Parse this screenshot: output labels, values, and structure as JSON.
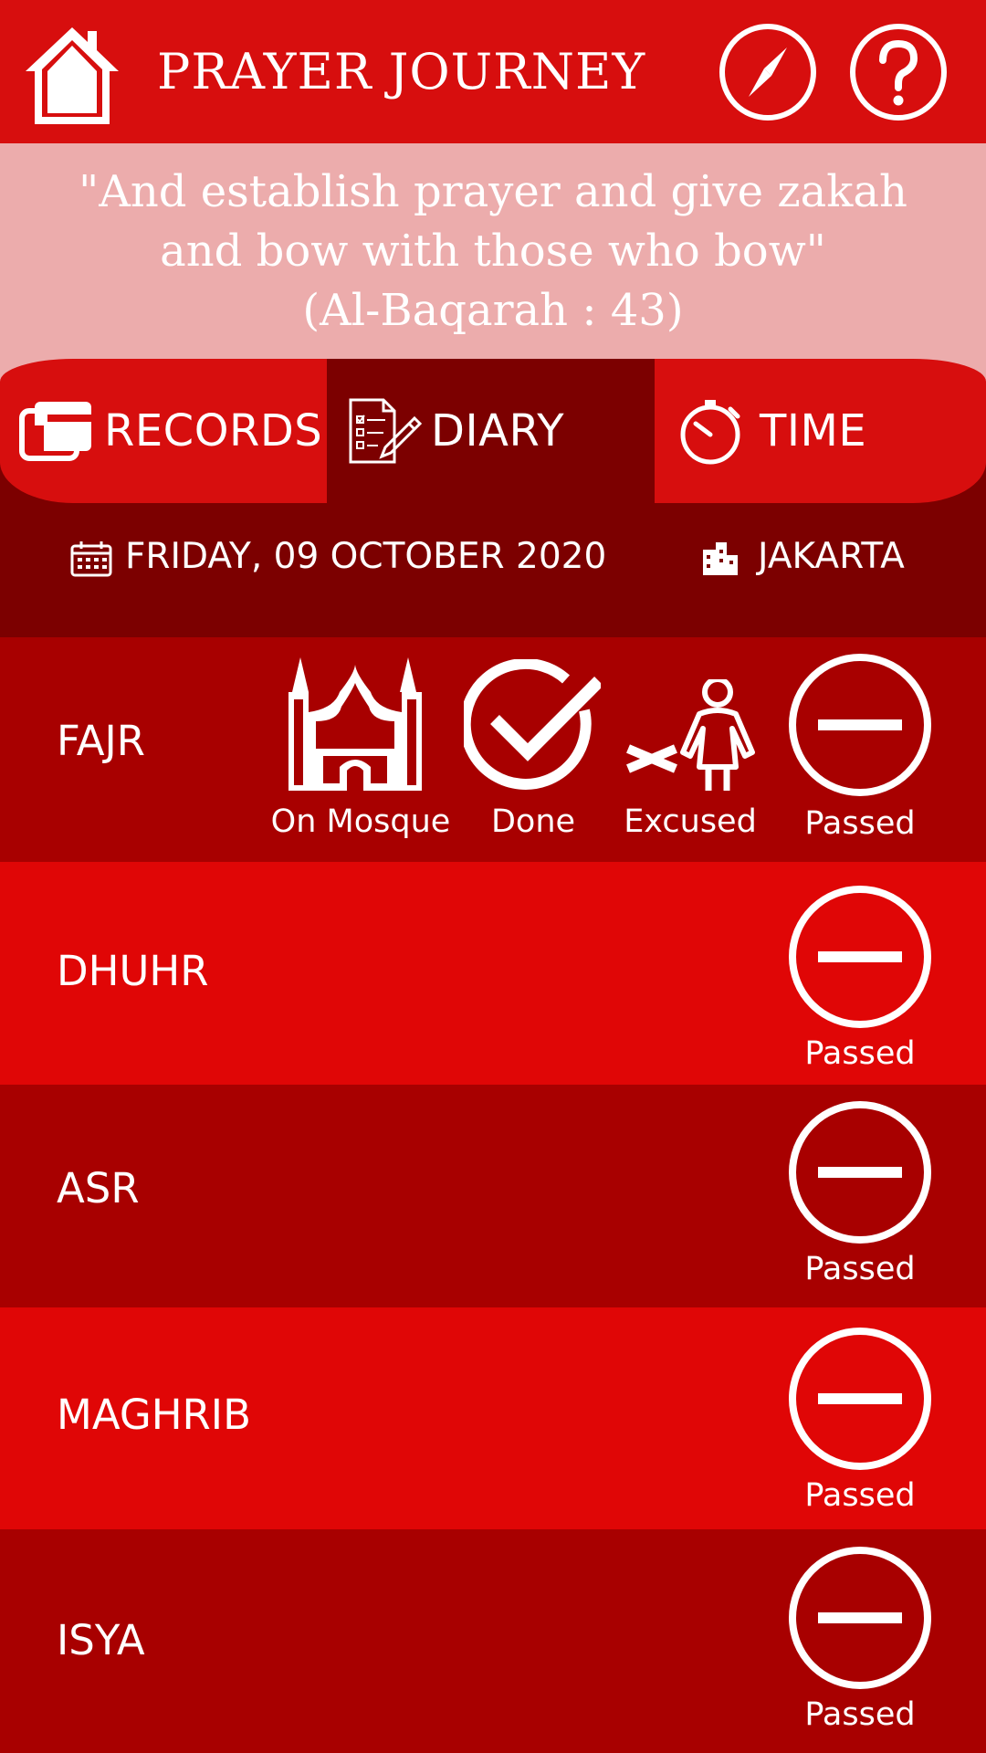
{
  "header": {
    "title": "PRAYER JOURNEY",
    "icons": [
      "home-icon",
      "compass-icon",
      "help-icon"
    ]
  },
  "quote": {
    "line1": "\"And establish prayer and give zakah",
    "line2": "and bow with those who bow\"",
    "source": "(Al-Baqarah : 43)"
  },
  "tabs": [
    {
      "label": "RECORDS",
      "icon": "records-icon",
      "active": false
    },
    {
      "label": "DIARY",
      "icon": "diary-icon",
      "active": true
    },
    {
      "label": "TIME",
      "icon": "stopwatch-icon",
      "active": false
    }
  ],
  "info": {
    "date": "FRIDAY, 09 OCTOBER 2020",
    "city": "JAKARTA"
  },
  "options": {
    "mosque": "On Mosque",
    "done": "Done",
    "excused": "Excused"
  },
  "prayers": [
    {
      "name": "FAJR",
      "status": "Passed"
    },
    {
      "name": "DHUHR",
      "status": "Passed"
    },
    {
      "name": "ASR",
      "status": "Passed"
    },
    {
      "name": "MAGHRIB",
      "status": "Passed"
    },
    {
      "name": "ISYA",
      "status": "Passed"
    }
  ],
  "colors": {
    "header_red": "#d70e0e",
    "dark_red": "#7c0000",
    "row_dark": "#a80000",
    "row_light": "#e00606",
    "quote_pink": "#ecacac"
  }
}
